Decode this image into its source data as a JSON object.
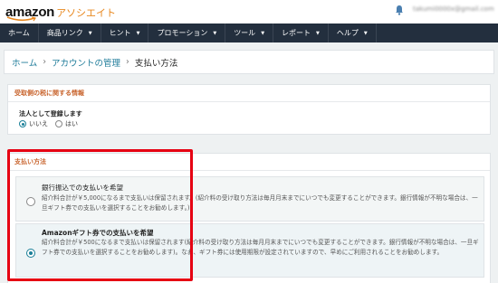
{
  "header": {
    "logo_main": "amazon",
    "logo_sub": "アソシエイト",
    "account_email": "takumi0000x@gmail.com"
  },
  "nav": {
    "items": [
      {
        "label": "ホーム",
        "has_dropdown": false
      },
      {
        "label": "商品リンク",
        "has_dropdown": true
      },
      {
        "label": "ヒント",
        "has_dropdown": true
      },
      {
        "label": "プロモーション",
        "has_dropdown": true
      },
      {
        "label": "ツール",
        "has_dropdown": true
      },
      {
        "label": "レポート",
        "has_dropdown": true
      },
      {
        "label": "ヘルプ",
        "has_dropdown": true
      }
    ]
  },
  "breadcrumb": {
    "home": "ホーム",
    "account": "アカウントの管理",
    "current": "支払い方法",
    "separator": "›"
  },
  "tax_section": {
    "title": "受取側の税に関する情報",
    "corporate_label": "法人として登録します",
    "option_no": "いいえ",
    "option_yes": "はい",
    "selected": "いいえ"
  },
  "payment_section": {
    "title": "支払い方法",
    "bank_title": "銀行振込での支払いを希望",
    "bank_desc": "紹介料合計が￥5,000になるまで支払いは保留されます。(紹介料の受け取り方法は毎月月末までにいつでも変更することができます。銀行情報が不明な場合は、一旦ギフト券での支払いを選択することをお勧めします。)",
    "gift_title": "Amazonギフト券での支払いを希望",
    "gift_desc": "紹介料合計が￥500になるまで支払いは保留されます(紹介料の受け取り方法は毎月月末までにいつでも変更することができます。銀行情報が不明な場合は、一旦ギフト券での支払いを選択することをお勧めします)。なお、ギフト券には使用期限が設定されていますので、早めにご利用されることをお勧めします。",
    "selected": "gift"
  },
  "colors": {
    "nav_bg": "#232f3e",
    "link": "#1f7c9a",
    "section_title": "#c8632c",
    "highlight": "#e60012",
    "logo_accent": "#e8881f"
  }
}
